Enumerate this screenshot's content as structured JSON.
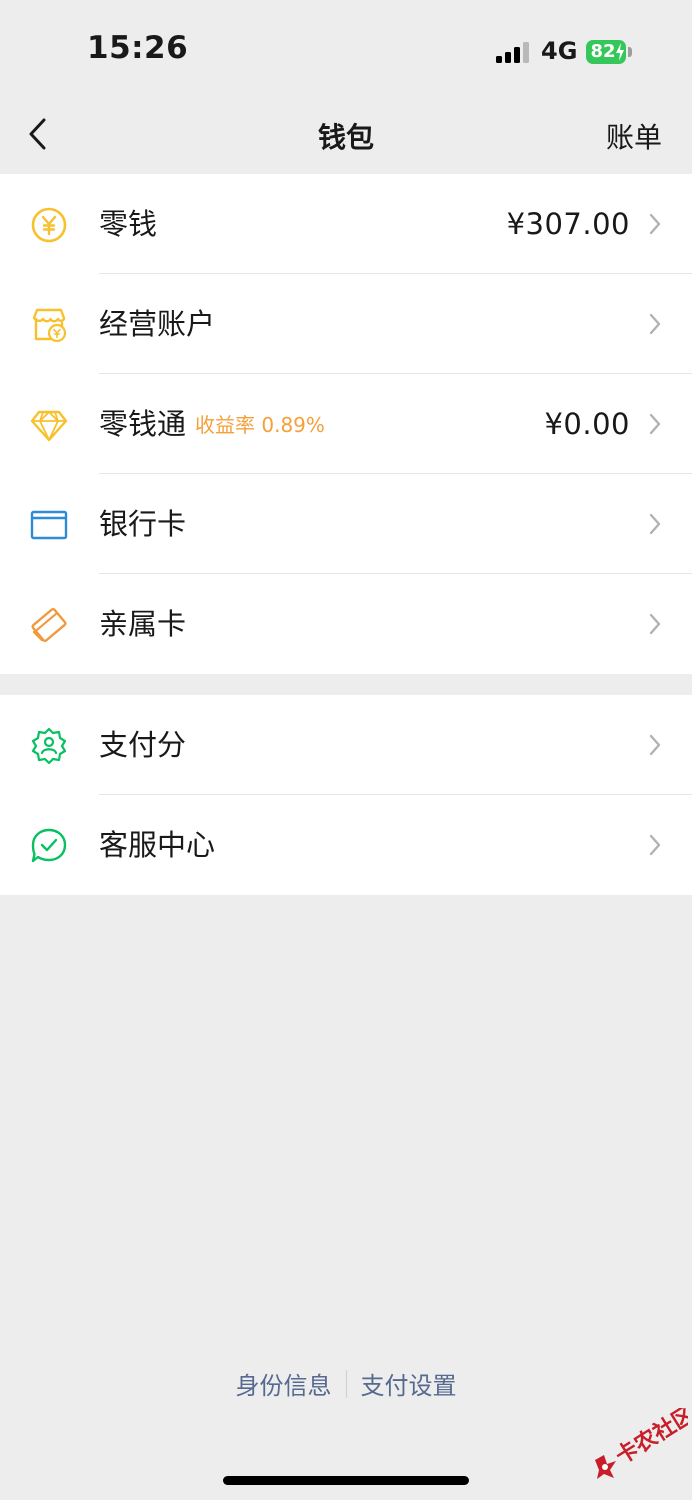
{
  "status": {
    "time": "15:26",
    "network": "4G",
    "battery": "82"
  },
  "nav": {
    "title": "钱包",
    "bill": "账单"
  },
  "group1": [
    {
      "label": "零钱",
      "value": "¥307.00",
      "icon": "coin-icon"
    },
    {
      "label": "经营账户",
      "icon": "shop-icon"
    },
    {
      "label": "零钱通",
      "rate": "收益率 0.89%",
      "value": "¥0.00",
      "icon": "diamond-icon"
    },
    {
      "label": "银行卡",
      "icon": "card-icon"
    },
    {
      "label": "亲属卡",
      "icon": "family-card-icon"
    }
  ],
  "group2": [
    {
      "label": "支付分",
      "icon": "badge-icon"
    },
    {
      "label": "客服中心",
      "icon": "service-icon"
    }
  ],
  "footer": {
    "identity": "身份信息",
    "settings": "支付设置"
  },
  "watermark": {
    "text": "卡农社区"
  },
  "colors": {
    "coin": "#f7c12d",
    "diamond": "#f7c12d",
    "card": "#2e8bd6",
    "family": "#f09a3c",
    "green": "#07c160",
    "rate": "#f5a03a",
    "link": "#56698f"
  }
}
